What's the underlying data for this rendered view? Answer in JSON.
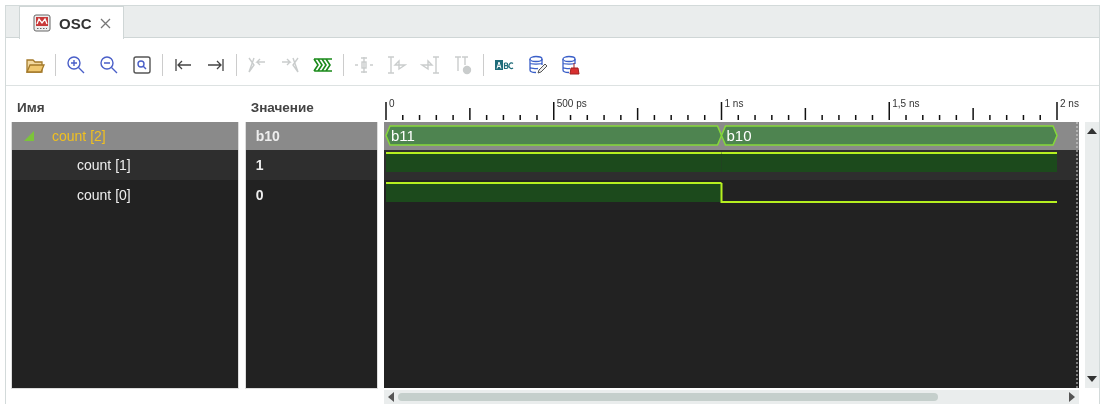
{
  "tabs": [
    {
      "label": "OSC",
      "selected": true
    }
  ],
  "toolbar": [
    [
      {
        "disabled": false
      }
    ],
    [
      {
        "disabled": false
      },
      {
        "disabled": false
      },
      {
        "disabled": false
      }
    ],
    [
      {
        "disabled": false
      },
      {
        "disabled": false
      }
    ],
    [
      {
        "disabled": true
      },
      {
        "disabled": true
      },
      {
        "disabled": false
      }
    ],
    [
      {
        "disabled": true
      },
      {
        "disabled": true
      },
      {
        "disabled": true
      },
      {
        "disabled": true
      }
    ],
    [
      {
        "disabled": false
      },
      {
        "disabled": false
      },
      {
        "disabled": false
      }
    ]
  ],
  "columns": {
    "name": "Имя",
    "value": "Значение"
  },
  "ruler": {
    "labels": [
      "0",
      "500 ps",
      "1 ns",
      "1,5 ns",
      "2 ns"
    ]
  },
  "signals": [
    {
      "name": "count [2]",
      "value": "b10",
      "kind": "bus",
      "selected": true,
      "expanded": true,
      "segments": [
        {
          "label": "b11"
        },
        {
          "label": "b10"
        }
      ],
      "children": [
        {
          "name": "count [1]",
          "value": "1",
          "kind": "bit",
          "selected": false,
          "segments": [
            {
              "high": true
            },
            {
              "high": true
            }
          ]
        },
        {
          "name": "count [0]",
          "value": "0",
          "kind": "bit",
          "selected": false,
          "segments": [
            {
              "high": true
            },
            {
              "high": false
            }
          ]
        }
      ]
    }
  ]
}
